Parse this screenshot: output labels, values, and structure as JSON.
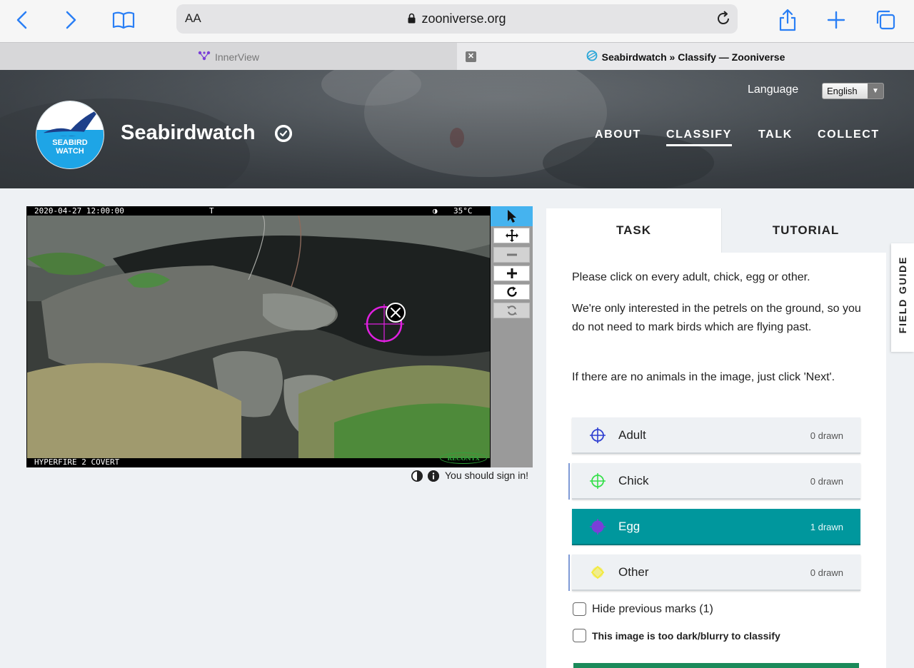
{
  "browser": {
    "text_size_label": "AA",
    "url": "zooniverse.org",
    "tabs": [
      {
        "title": "InnerView"
      },
      {
        "title": "Seabirdwatch » Classify — Zooniverse"
      }
    ],
    "tab_close_glyph": "✕"
  },
  "header": {
    "language_label": "Language",
    "language_value": "English",
    "language_arrow": "▼",
    "logo_text_line1": "SEABIRD",
    "logo_text_line2": "WATCH",
    "project_title": "Seabirdwatch",
    "nav": [
      {
        "label": "ABOUT"
      },
      {
        "label": "CLASSIFY"
      },
      {
        "label": "TALK"
      },
      {
        "label": "COLLECT"
      }
    ],
    "active_nav": "CLASSIFY"
  },
  "subject": {
    "timestamp": "2020-04-27 12:00:00",
    "camera_flag": "T",
    "temperature": "35°C",
    "camera_model": "HYPERFIRE 2 COVERT",
    "brand": "RECONYX",
    "meta_text": "You should sign in!"
  },
  "task": {
    "tabs": [
      {
        "label": "TASK"
      },
      {
        "label": "TUTORIAL"
      }
    ],
    "instructions": [
      "Please click on every adult, chick, egg or other.",
      "We're only interested in the petrels on the ground, so you do not need to mark birds which are flying past.",
      "If there are no animals in the image, just click 'Next'."
    ],
    "tools": [
      {
        "label": "Adult",
        "count": "0 drawn",
        "color": "#2f3fd1"
      },
      {
        "label": "Chick",
        "count": "0 drawn",
        "color": "#35e04a"
      },
      {
        "label": "Egg",
        "count": "1 drawn",
        "color": "#7a3fd8"
      },
      {
        "label": "Other",
        "count": "0 drawn",
        "color": "#f3ea3a"
      }
    ],
    "selected_tool": "Egg",
    "hide_marks_label": "Hide previous marks (1)",
    "too_dark_label": "This image is too dark/blurry to classify"
  },
  "field_guide": {
    "label": "FIELD GUIDE"
  },
  "colors": {
    "accent_teal": "#00979d",
    "marker_magenta": "#e020e0",
    "tool_active_blue": "#45b3ef"
  }
}
